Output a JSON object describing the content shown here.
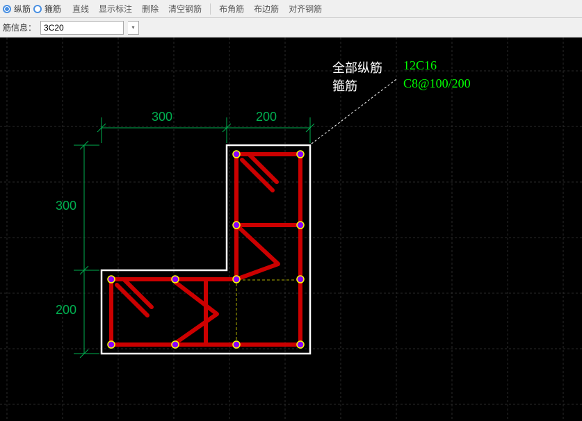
{
  "toolbar": {
    "radios": {
      "longitudinal": "纵筋",
      "stirrup": "箍筋"
    },
    "selected_radio": "longitudinal",
    "buttons": [
      "直线",
      "显示标注",
      "删除",
      "清空钢筋"
    ],
    "buttons2": [
      "布角筋",
      "布边筋",
      "对齐钢筋"
    ]
  },
  "info": {
    "label": "筋信息：",
    "value": "3C20"
  },
  "annotations": {
    "all_long_label": "全部纵筋",
    "all_long_value": "12C16",
    "stirrup_label": "箍筋",
    "stirrup_value": "C8@100/200"
  },
  "dimensions": {
    "top1": "300",
    "top2": "200",
    "left1": "300",
    "left2": "200"
  },
  "colors": {
    "grid": "#2a2a2a",
    "dim": "#00b050",
    "outline": "#ffffff",
    "tie_dash": "#b0b000",
    "rebar": "#ff0000",
    "stirrup_line": "#cc0000",
    "dot_out": "#ffff00",
    "dot_in": "#8b00ff"
  }
}
